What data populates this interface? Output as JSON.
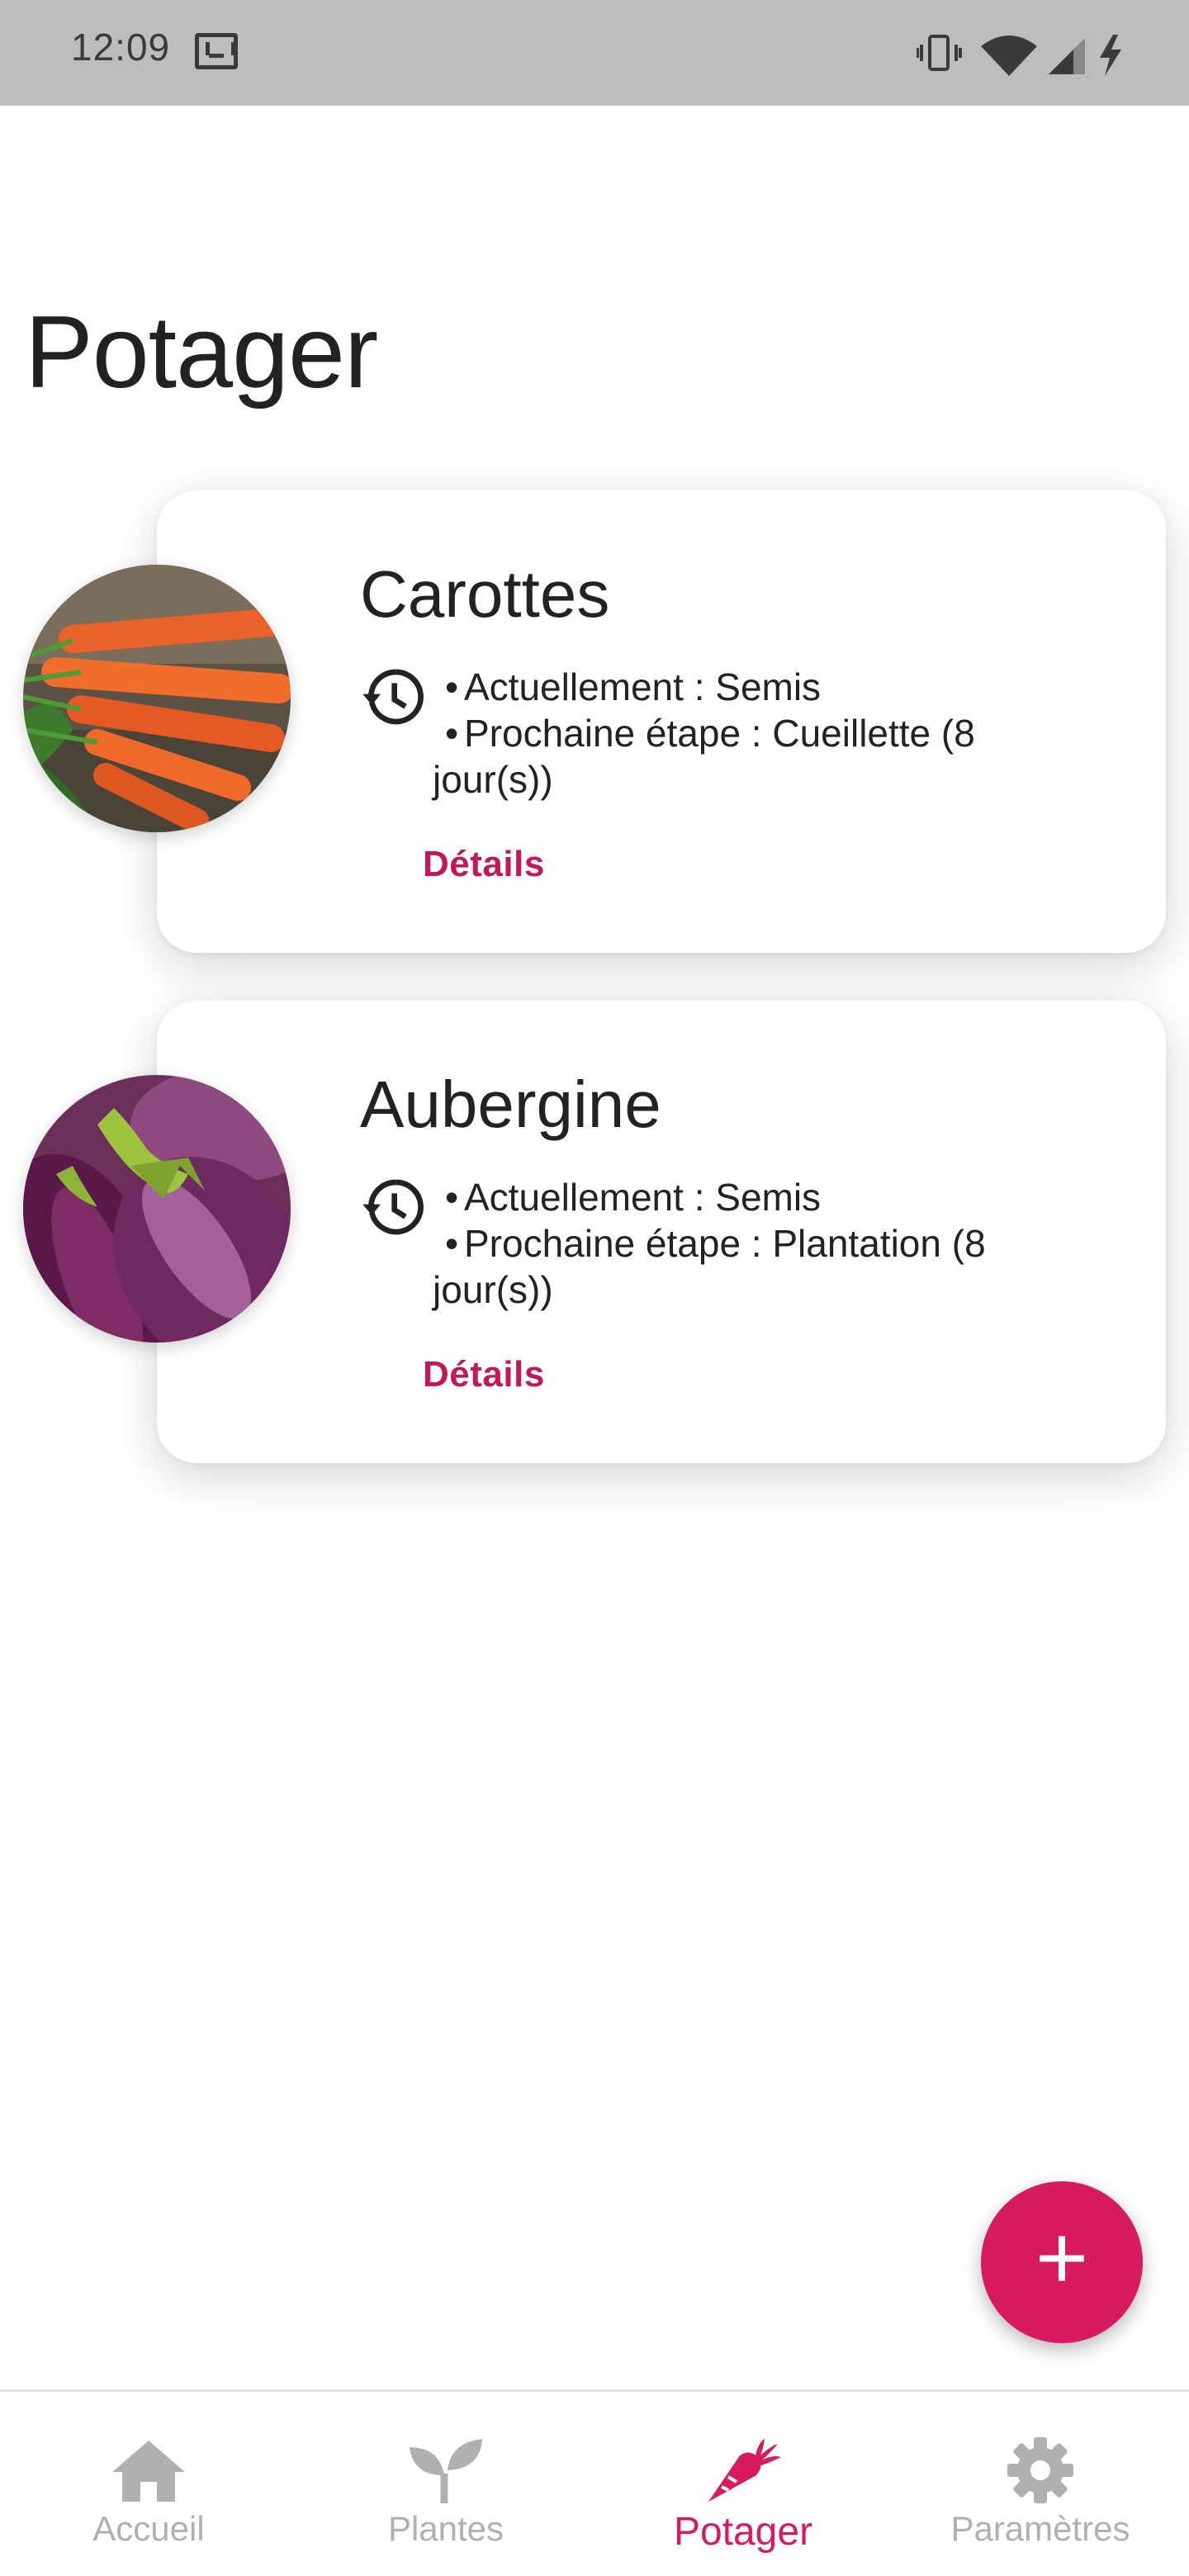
{
  "status_bar": {
    "time": "12:09"
  },
  "page": {
    "title": "Potager"
  },
  "plants": [
    {
      "name": "Carottes",
      "current": "Actuellement : Semis",
      "next_line1": "Prochaine étape : Cueillette (8",
      "next_line2": "jour(s))",
      "details_label": "Détails"
    },
    {
      "name": "Aubergine",
      "current": "Actuellement : Semis",
      "next_line1": "Prochaine étape : Plantation (8",
      "next_line2": "jour(s))",
      "details_label": "Détails"
    }
  ],
  "fab": {
    "label": "+"
  },
  "nav": {
    "items": [
      {
        "label": "Accueil",
        "icon": "home-icon",
        "active": false
      },
      {
        "label": "Plantes",
        "icon": "sprout-icon",
        "active": false
      },
      {
        "label": "Potager",
        "icon": "carrot-icon",
        "active": true
      },
      {
        "label": "Paramètres",
        "icon": "gear-icon",
        "active": false
      }
    ]
  },
  "colors": {
    "accent": "#d81b60",
    "link": "#c2185b",
    "inactive": "#b0b0b0",
    "status_bar": "#bdbdbd"
  }
}
